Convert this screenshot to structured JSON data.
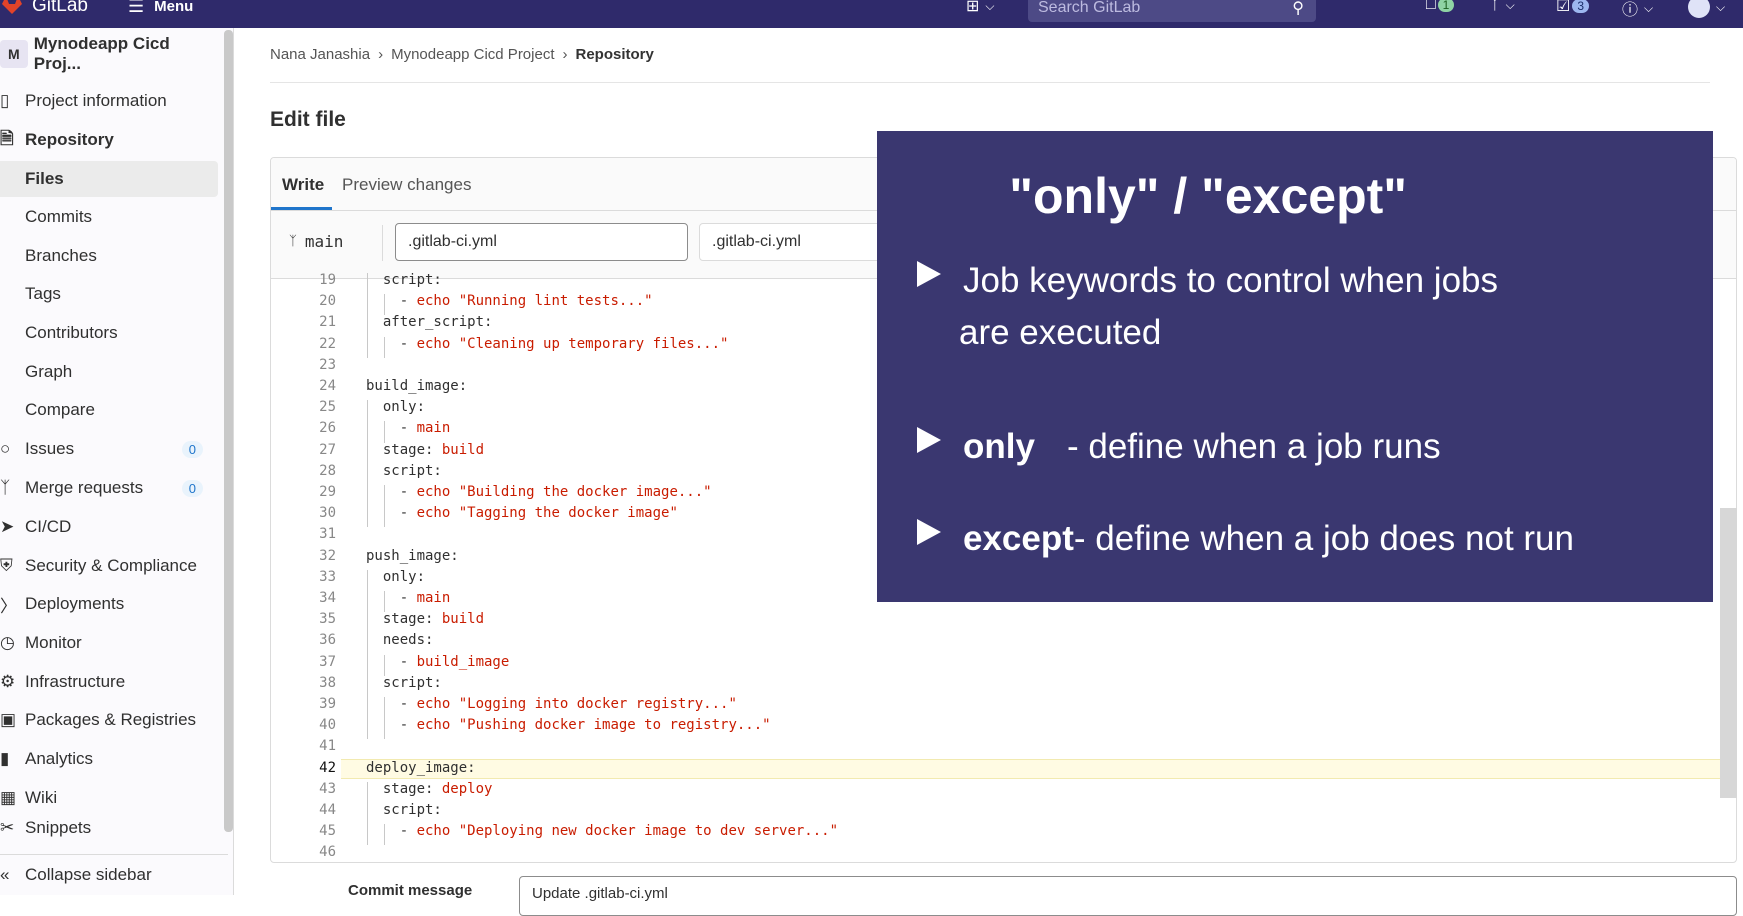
{
  "topbar": {
    "brand": "GitLab",
    "menu": "Menu",
    "search_placeholder": "Search GitLab",
    "mr_count": "1",
    "todo_count": "3"
  },
  "sidebar": {
    "project_initial": "M",
    "project_name": "Mynodeapp Cicd Proj...",
    "items": [
      {
        "label": "Project information"
      },
      {
        "label": "Repository"
      },
      {
        "label": "Files"
      },
      {
        "label": "Commits"
      },
      {
        "label": "Branches"
      },
      {
        "label": "Tags"
      },
      {
        "label": "Contributors"
      },
      {
        "label": "Graph"
      },
      {
        "label": "Compare"
      },
      {
        "label": "Issues",
        "badge": "0"
      },
      {
        "label": "Merge requests",
        "badge": "0"
      },
      {
        "label": "CI/CD"
      },
      {
        "label": "Security & Compliance"
      },
      {
        "label": "Deployments"
      },
      {
        "label": "Monitor"
      },
      {
        "label": "Infrastructure"
      },
      {
        "label": "Packages & Registries"
      },
      {
        "label": "Analytics"
      },
      {
        "label": "Wiki"
      },
      {
        "label": "Snippets"
      }
    ],
    "collapse": "Collapse sidebar"
  },
  "breadcrumb": {
    "a": "Nana Janashia",
    "b": "Mynodeapp Cicd Project",
    "c": "Repository"
  },
  "page_title": "Edit file",
  "tabs": {
    "write": "Write",
    "preview": "Preview changes"
  },
  "file": {
    "branch": "main",
    "path": ".gitlab-ci.yml",
    "name": ".gitlab-ci.yml"
  },
  "code": [
    {
      "n": "19",
      "t": "  script:"
    },
    {
      "n": "20",
      "t": "    - echo \"Running lint tests...\""
    },
    {
      "n": "21",
      "t": "  after_script:"
    },
    {
      "n": "22",
      "t": "    - echo \"Cleaning up temporary files...\""
    },
    {
      "n": "23",
      "t": ""
    },
    {
      "n": "24",
      "t": "build_image:"
    },
    {
      "n": "25",
      "t": "  only:"
    },
    {
      "n": "26",
      "t": "    - main"
    },
    {
      "n": "27",
      "t": "  stage: build"
    },
    {
      "n": "28",
      "t": "  script:"
    },
    {
      "n": "29",
      "t": "    - echo \"Building the docker image...\""
    },
    {
      "n": "30",
      "t": "    - echo \"Tagging the docker image\""
    },
    {
      "n": "31",
      "t": ""
    },
    {
      "n": "32",
      "t": "push_image:"
    },
    {
      "n": "33",
      "t": "  only:"
    },
    {
      "n": "34",
      "t": "    - main"
    },
    {
      "n": "35",
      "t": "  stage: build"
    },
    {
      "n": "36",
      "t": "  needs:"
    },
    {
      "n": "37",
      "t": "    - build_image"
    },
    {
      "n": "38",
      "t": "  script:"
    },
    {
      "n": "39",
      "t": "    - echo \"Logging into docker registry...\""
    },
    {
      "n": "40",
      "t": "    - echo \"Pushing docker image to registry...\""
    },
    {
      "n": "41",
      "t": ""
    },
    {
      "n": "42",
      "t": "deploy_image:"
    },
    {
      "n": "43",
      "t": "  stage: deploy"
    },
    {
      "n": "44",
      "t": "  script:"
    },
    {
      "n": "45",
      "t": "    - echo \"Deploying new docker image to dev server...\""
    },
    {
      "n": "46",
      "t": ""
    }
  ],
  "overlay": {
    "title": "\"only\" / \"except\"",
    "b1": "Job keywords to control when jobs",
    "b1b": "are executed",
    "b2k": "only",
    "b2": " - define when a job runs",
    "b3k": "except",
    "b3": " - define when a job does not run"
  },
  "commit": {
    "label": "Commit message",
    "value": "Update .gitlab-ci.yml"
  }
}
